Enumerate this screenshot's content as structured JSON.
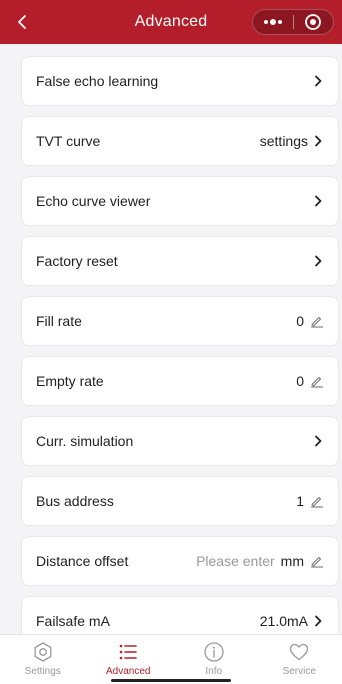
{
  "header": {
    "title": "Advanced",
    "accent": "#b41e2a",
    "back_icon": "chevron-left-icon",
    "more_icon": "more-dots-icon",
    "close_icon": "target-circle-icon"
  },
  "rows": [
    {
      "label": "False echo learning",
      "value": "",
      "action": "chevron"
    },
    {
      "label": "TVT curve",
      "value": "settings",
      "action": "chevron"
    },
    {
      "label": "Echo curve viewer",
      "value": "",
      "action": "chevron"
    },
    {
      "label": "Factory reset",
      "value": "",
      "action": "chevron"
    },
    {
      "label": "Fill rate",
      "value": "0",
      "action": "edit"
    },
    {
      "label": "Empty rate",
      "value": "0",
      "action": "edit"
    },
    {
      "label": "Curr. simulation",
      "value": "",
      "action": "chevron"
    },
    {
      "label": "Bus address",
      "value": "1",
      "action": "edit"
    },
    {
      "label": "Distance offset",
      "placeholder": "Please enter",
      "unit": "mm",
      "action": "edit"
    },
    {
      "label": "Failsafe mA",
      "value": "21.0mA",
      "action": "chevron"
    }
  ],
  "tabbar": {
    "tabs": [
      {
        "label": "Settings",
        "icon": "settings-hexagon-icon",
        "active": false
      },
      {
        "label": "Advanced",
        "icon": "list-icon",
        "active": true
      },
      {
        "label": "Info",
        "icon": "info-circle-icon",
        "active": false
      },
      {
        "label": "Service",
        "icon": "heart-icon",
        "active": false
      }
    ]
  }
}
